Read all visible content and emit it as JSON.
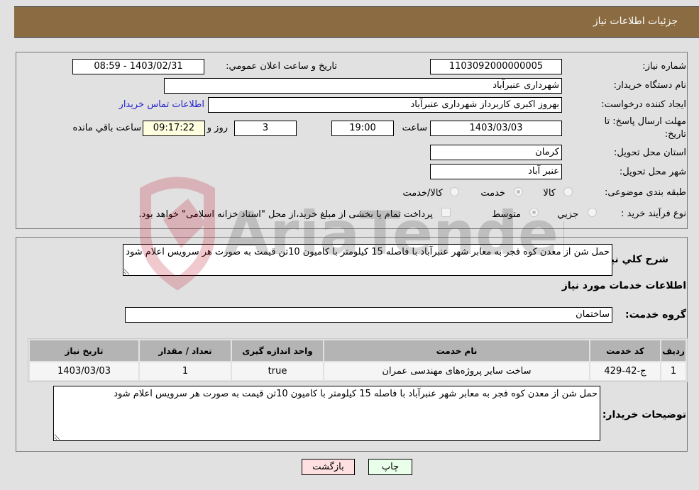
{
  "header": {
    "title": "جزئیات اطلاعات نیاز"
  },
  "form": {
    "need_number_label": "شماره نیاز:",
    "need_number": "1103092000000005",
    "announce_label": "تاریخ و ساعت اعلان عمومي:",
    "announce_value": "1403/02/31 - 08:59",
    "buyer_org_label": "نام دستگاه خریدار:",
    "buyer_org": "شهرداری عنبرآباد",
    "requester_label": "ایجاد کننده درخواست:",
    "requester": "بهروز اکبری کاربرداز شهرداری عنبرآباد",
    "buyer_contact_link": "اطلاعات تماس خریدار",
    "deadline_label_line1": "مهلت ارسال پاسخ: تا",
    "deadline_label_line2": "تاریخ:",
    "deadline_date": "1403/03/03",
    "time_label": "ساعت",
    "deadline_time": "19:00",
    "days_remaining": "3",
    "days_label": "روز و",
    "time_remaining": "09:17:22",
    "time_remaining_label": "ساعت باقي مانده",
    "province_label": "استان محل تحویل:",
    "province": "کرمان",
    "city_label": "شهر محل تحویل:",
    "city": "عنبر آباد",
    "category_label": "طبقه بندی موضوعی:",
    "category_options": [
      {
        "label": "کالا",
        "checked": false
      },
      {
        "label": "خدمت",
        "checked": true
      },
      {
        "label": "کالا/خدمت",
        "checked": false
      }
    ],
    "process_label": "نوع فرآیند خرید :",
    "process_options": [
      {
        "label": "جزيي",
        "checked": false
      },
      {
        "label": "متوسط",
        "checked": true
      }
    ],
    "treasury_checkbox_checked": false,
    "treasury_note": "پرداخت تمام یا بخشی از مبلغ خرید،از محل \"اسناد خزانه اسلامی\" خواهد بود."
  },
  "description": {
    "label": "شرح كلي نیاز:",
    "text": "حمل شن از معدن کوه فجر به معابر شهر عنبرآباد با فاصله 15 کیلومتر با کامیون 10تن قیمت به صورت هر سرویس اعلام شود"
  },
  "services": {
    "section_title": "اطلاعات خدمات مورد نیاز",
    "group_label": "گروه خدمت:",
    "group_value": "ساختمان",
    "columns": [
      "ردیف",
      "کد خدمت",
      "نام خدمت",
      "واحد اندازه گیری",
      "تعداد / مقدار",
      "تاریخ نیاز"
    ],
    "rows": [
      [
        "1",
        "ج-42-429",
        "ساخت سایر پروژه‌های مهندسی عمران",
        "true",
        "1",
        "1403/03/03"
      ]
    ]
  },
  "buyer_notes": {
    "label": "توضیحات خریدار:",
    "text": "حمل شن از معدن کوه فجر به معابر شهر عنبرآباد با فاصله 15 کیلومتر با کامیون 10تن قیمت به صورت هر سرویس اعلام شود"
  },
  "buttons": {
    "print": "چاپ",
    "back": "بازگشت"
  },
  "colors": {
    "header_bg": "#8b6c42",
    "print_bg": "#eaffea",
    "back_bg": "#ffe0e0",
    "link": "#2222cc"
  },
  "watermark": {
    "text": "AriaTender.neT"
  }
}
